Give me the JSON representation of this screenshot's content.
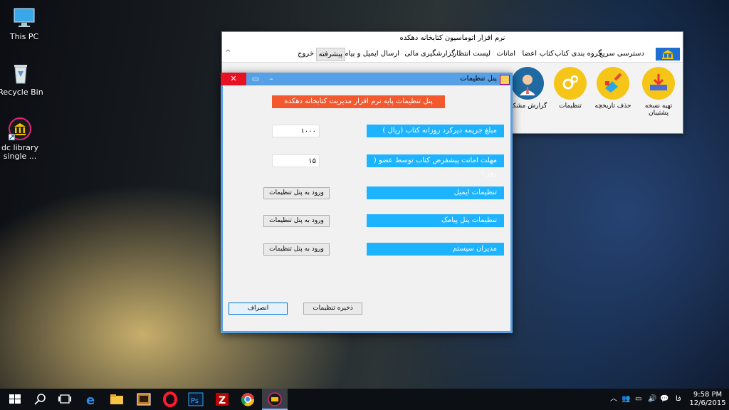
{
  "desktop": {
    "icons": [
      {
        "label": "This PC"
      },
      {
        "label": "Recycle Bin"
      },
      {
        "label": "dc library single ..."
      }
    ]
  },
  "app": {
    "title": "نرم افزار اتوماسیون کتابخانه دهکده",
    "menu": [
      "دسترسی سریع",
      "گروه بندی کتاب",
      "کتاب",
      "اعضا",
      "امانات",
      "لیست انتظار",
      "گزارشگیری",
      "مالی",
      "ارسال ایمیل و پیامک",
      "پیشرفته",
      "خروج"
    ],
    "collapse_glyph": "^",
    "ribbon": [
      {
        "label": "تهیه نسخه پشتیبان",
        "icon": "backup-icon"
      },
      {
        "label": "حذف تاریخچه",
        "icon": "broom-icon"
      },
      {
        "label": "تنظیمات",
        "icon": "gears-icon"
      },
      {
        "label": "گزارش مشکل",
        "icon": "support-agent-icon"
      }
    ]
  },
  "dialog": {
    "title": "پنل تنظیمات",
    "header": "پنل تنظیمات پایه نرم افزار مدیریت کتابخانه دهکده",
    "fine_label": "مبلغ جریمه دیرکرد روزانه کتاب (ریال )",
    "fine_value": "۱۰۰۰",
    "loan_label": "مهلت امانت پیشفرض کتاب توسط عضو ( روز )",
    "loan_value": "۱۵",
    "email_label": "تنظیمات ایمیل",
    "sms_label": "تنظیمات پنل پیامک",
    "admins_label": "مدیران سیستم",
    "enter_settings": "ورود به پنل تنظیمات",
    "save": "ذخیره تنظیمات",
    "cancel": "انصراف"
  },
  "taskbar": {
    "lang": "فا",
    "time": "9:58 PM",
    "date": "12/6/2015"
  },
  "colors": {
    "accent_blue": "#1db3ff",
    "header_orange": "#f3582e",
    "window_border": "#55a0e6",
    "close_red": "#e81123"
  }
}
